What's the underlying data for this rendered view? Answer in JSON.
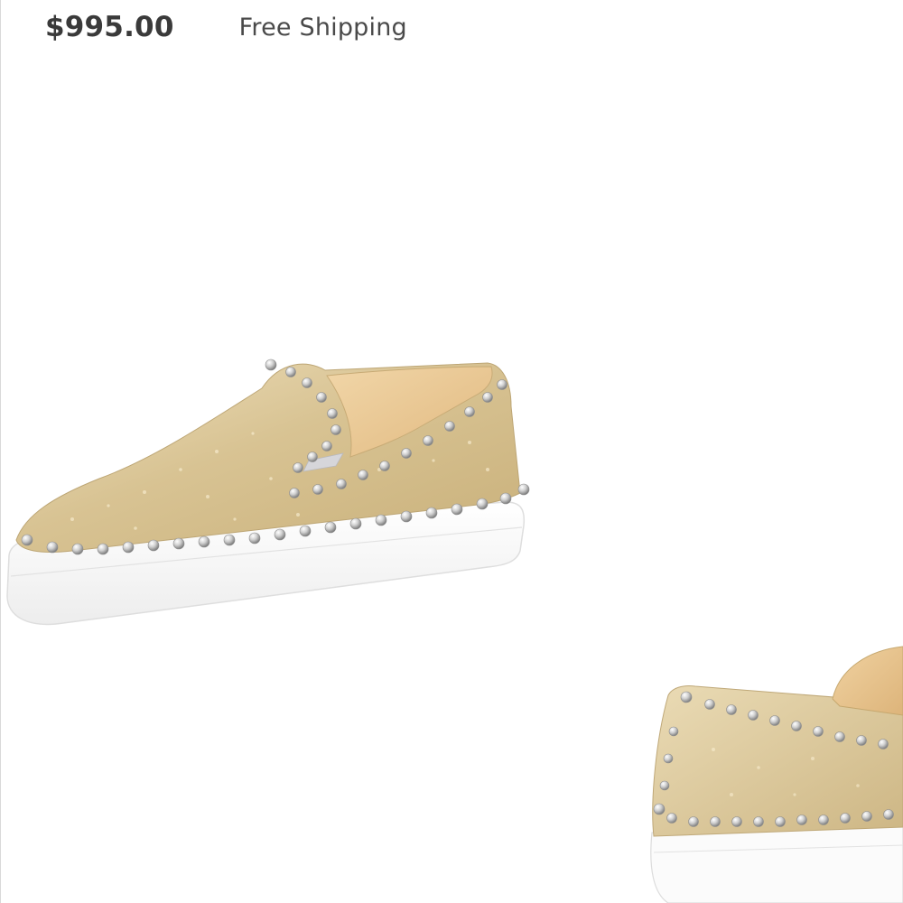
{
  "product": {
    "price": "$995.00",
    "shipping": "Free Shipping"
  },
  "images": {
    "main": "gold-glitter-spiked-slip-on-sneaker",
    "thumbnail": "gold-glitter-spiked-slip-on-sneaker-heel-view"
  },
  "colors": {
    "price_text": "#3a3a3a",
    "shipping_text": "#4a4a4a",
    "shoe_gold": "#d9c7a0",
    "sole_white": "#fafafa",
    "stud_silver": "#c9c9c9"
  }
}
